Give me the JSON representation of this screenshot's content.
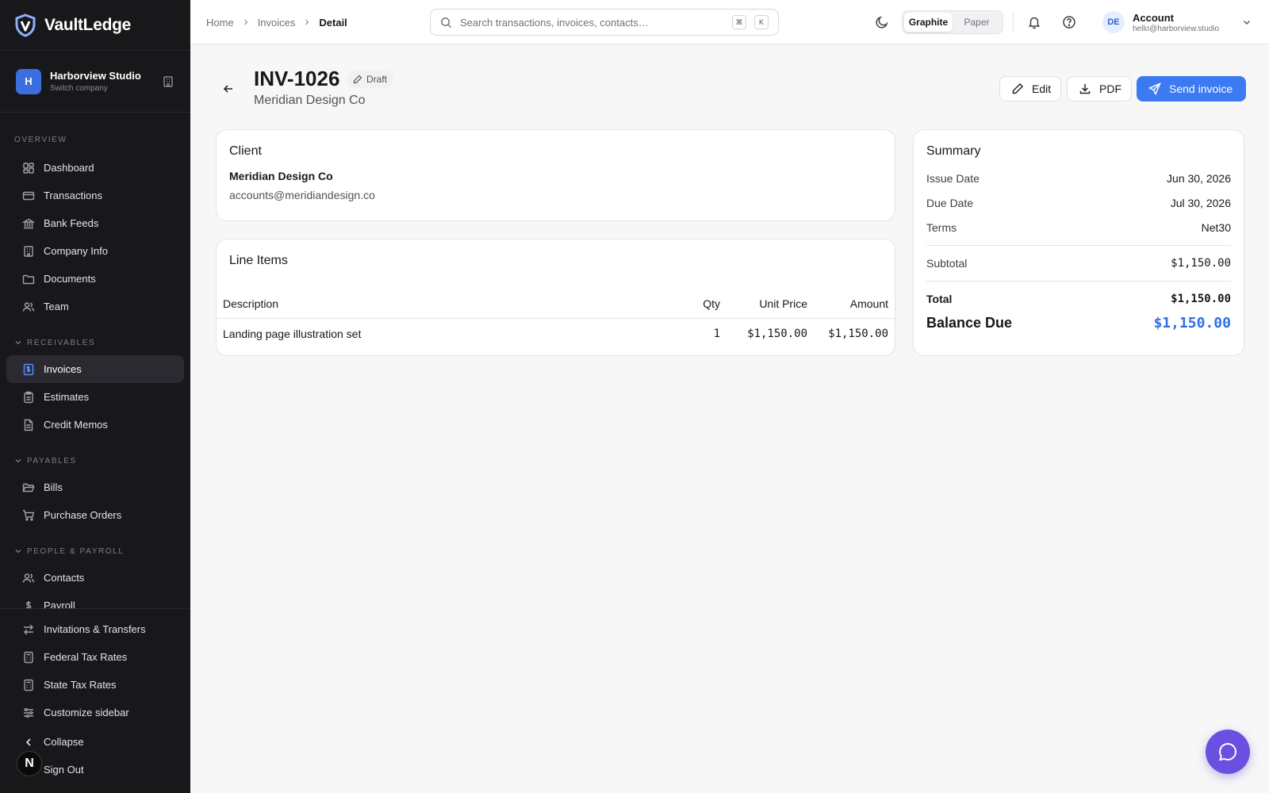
{
  "app": {
    "name": "VaultLedge"
  },
  "company": {
    "initial": "H",
    "name": "Harborview Studio",
    "sub": "Switch company"
  },
  "sidebar": {
    "sections": [
      {
        "label": "Overview",
        "items": [
          {
            "label": "Dashboard",
            "icon": "grid-icon"
          },
          {
            "label": "Transactions",
            "icon": "card-icon"
          },
          {
            "label": "Bank Feeds",
            "icon": "bank-icon"
          },
          {
            "label": "Company Info",
            "icon": "building-icon"
          },
          {
            "label": "Documents",
            "icon": "folder-icon"
          },
          {
            "label": "Team",
            "icon": "users-icon"
          }
        ]
      },
      {
        "label": "Receivables",
        "items": [
          {
            "label": "Invoices",
            "icon": "invoice-icon",
            "active": true
          },
          {
            "label": "Estimates",
            "icon": "clipboard-icon"
          },
          {
            "label": "Credit Memos",
            "icon": "file-icon"
          }
        ]
      },
      {
        "label": "Payables",
        "items": [
          {
            "label": "Bills",
            "icon": "folder-open-icon"
          },
          {
            "label": "Purchase Orders",
            "icon": "cart-icon"
          }
        ]
      },
      {
        "label": "People & Payroll",
        "items": [
          {
            "label": "Contacts",
            "icon": "users-icon"
          },
          {
            "label": "Payroll",
            "icon": "dollar-icon"
          }
        ]
      }
    ],
    "bottom": [
      {
        "label": "Invitations & Transfers",
        "icon": "transfer-icon"
      },
      {
        "label": "Federal Tax Rates",
        "icon": "calculator-icon"
      },
      {
        "label": "State Tax Rates",
        "icon": "calculator-icon"
      },
      {
        "label": "Customize sidebar",
        "icon": "sliders-icon"
      },
      {
        "label": "Collapse",
        "icon": "chevron-left-icon"
      },
      {
        "label": "Sign Out",
        "icon": "logout-icon"
      }
    ],
    "n_badge": "N"
  },
  "breadcrumb": [
    "Home",
    "Invoices",
    "Detail"
  ],
  "search": {
    "placeholder": "Search transactions, invoices, contacts…",
    "kbd1": "⌘",
    "kbd2": "K"
  },
  "theme": {
    "options": [
      "Graphite",
      "Paper"
    ],
    "selected": "Graphite"
  },
  "account": {
    "initials": "DE",
    "label": "Account",
    "email": "hello@harborview.studio"
  },
  "invoice": {
    "number": "INV-1026",
    "status": "Draft",
    "client": "Meridian Design Co",
    "actions": {
      "edit": "Edit",
      "pdf": "PDF",
      "send": "Send invoice"
    }
  },
  "client_card": {
    "title": "Client",
    "name": "Meridian Design Co",
    "email": "accounts@meridiandesign.co"
  },
  "line_items": {
    "title": "Line Items",
    "columns": [
      "Description",
      "Qty",
      "Unit Price",
      "Amount"
    ],
    "rows": [
      {
        "description": "Landing page illustration set",
        "qty": "1",
        "unit_price": "$1,150.00",
        "amount": "$1,150.00"
      }
    ]
  },
  "summary": {
    "title": "Summary",
    "issue_label": "Issue Date",
    "issue_value": "Jun 30, 2026",
    "due_label": "Due Date",
    "due_value": "Jul 30, 2026",
    "terms_label": "Terms",
    "terms_value": "Net30",
    "subtotal_label": "Subtotal",
    "subtotal_value": "$1,150.00",
    "total_label": "Total",
    "total_value": "$1,150.00",
    "balance_label": "Balance Due",
    "balance_value": "$1,150.00"
  },
  "colors": {
    "accent": "#3b7af0",
    "sidebar_bg": "#18181b",
    "chat": "#6b4fe0",
    "balance": "#2f6fe6"
  }
}
